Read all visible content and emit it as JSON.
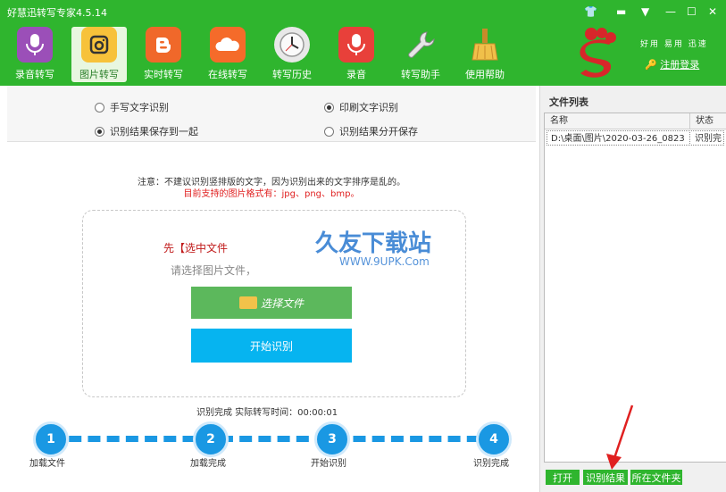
{
  "window": {
    "title": "好慧迅转写专家4.5.14"
  },
  "nav": [
    {
      "label": "录音转写",
      "icon": "microphone-icon",
      "color": "#9b4fb8"
    },
    {
      "label": "图片转写",
      "icon": "image-icon",
      "color": "#f7c23a"
    },
    {
      "label": "实时转写",
      "icon": "blogger-icon",
      "color": "#f0682a"
    },
    {
      "label": "在线转写",
      "icon": "cloud-icon",
      "color": "#f56b2a"
    },
    {
      "label": "转写历史",
      "icon": "clock-icon",
      "color": "#e8e8e8"
    },
    {
      "label": "录音",
      "icon": "mic-record-icon",
      "color": "#e8403a"
    },
    {
      "label": "转写助手",
      "icon": "wrench-icon",
      "color": "#dddddd"
    },
    {
      "label": "使用帮助",
      "icon": "broom-icon",
      "color": "#e8b33a"
    }
  ],
  "header": {
    "slogan": "好用 易用 迅速",
    "register": "注册登录"
  },
  "options": {
    "handwrite": "手写文字识别",
    "print": "印刷文字识别",
    "save_together": "识别结果保存到一起",
    "save_separate": "识别结果分开保存"
  },
  "notes": {
    "line1": "注意：不建议识别竖排版的文字，因为识别出来的文字排序是乱的。",
    "line2": "目前支持的图片格式有：jpg、png、bmp。"
  },
  "dropzone": {
    "hint_red_prefix": "先【选中文件",
    "hint_gray": "请选择图片文件，",
    "select_button": "选择文件",
    "start_button": "开始识别"
  },
  "status": "识别完成  实际转写时间：00:00:01",
  "steps": [
    {
      "num": "1",
      "label": "加载文件"
    },
    {
      "num": "2",
      "label": "加载完成"
    },
    {
      "num": "3",
      "label": "开始识别"
    },
    {
      "num": "4",
      "label": "识别完成"
    }
  ],
  "file_list": {
    "title": "文件列表",
    "col_name": "名称",
    "col_status": "状态",
    "rows": [
      {
        "name": "D:\\桌面\\图片\\2020-03-26_0823",
        "status": "识别完"
      }
    ]
  },
  "bottom_buttons": {
    "open": "打开",
    "result": "识别结果",
    "folder": "所在文件夹"
  },
  "watermark": {
    "main": "久友下载站",
    "sub": "WWW.9UPK.Com"
  }
}
